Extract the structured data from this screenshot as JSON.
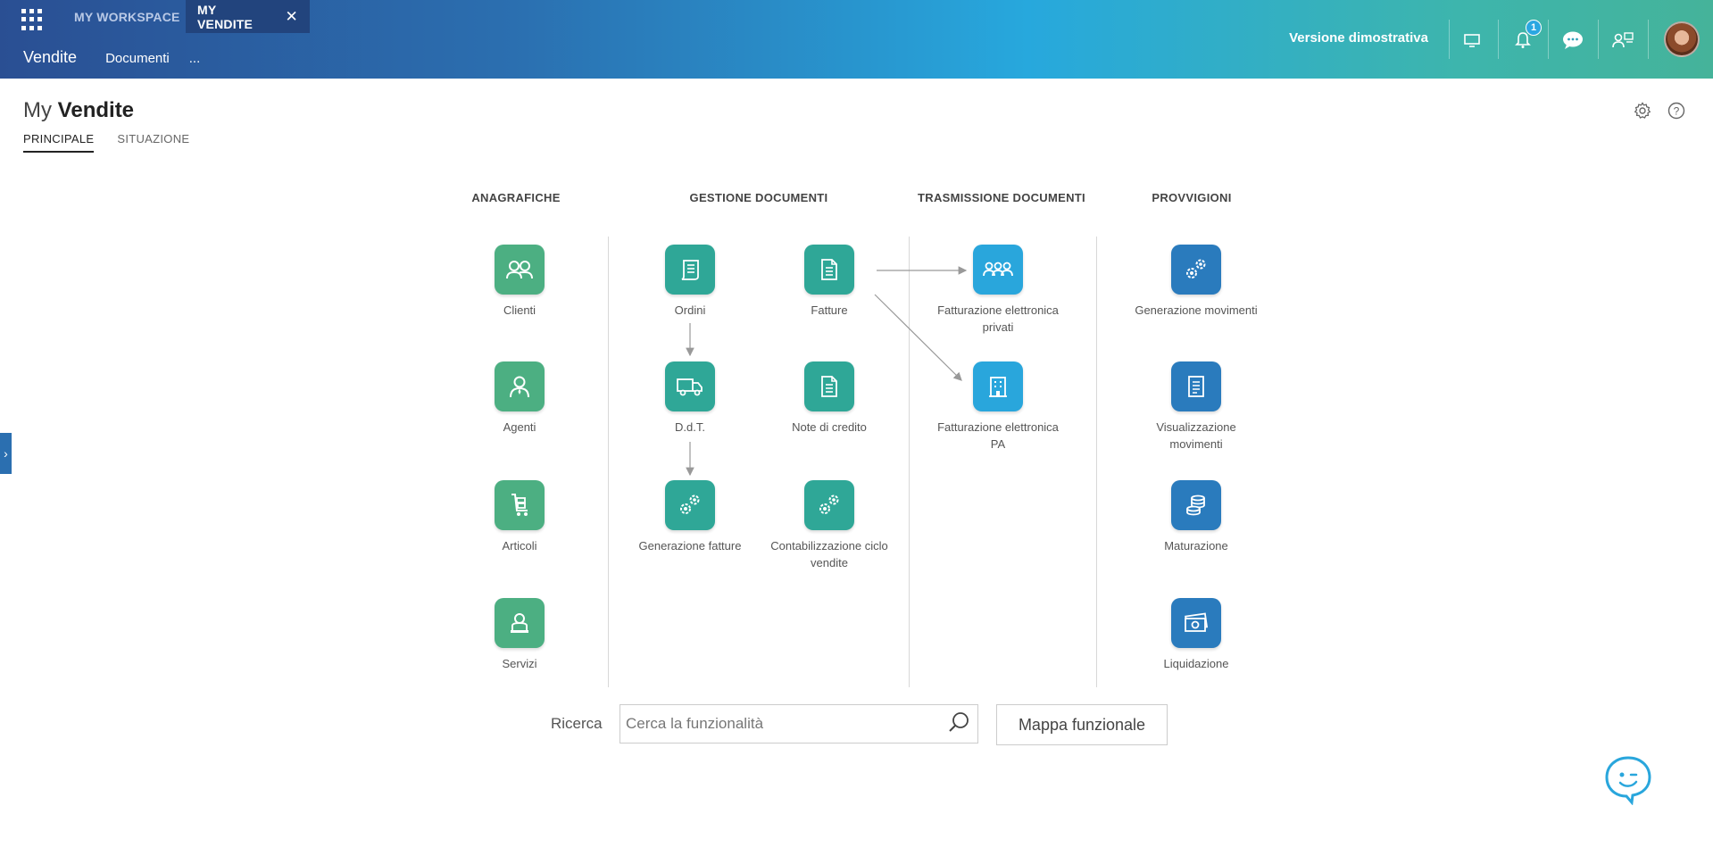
{
  "header": {
    "app_menu_icon": "grid-icon",
    "tabs": [
      {
        "label": "MY WORKSPACE",
        "active": false
      },
      {
        "label": "MY VENDITE",
        "active": true,
        "close": "✕"
      }
    ],
    "subnav": {
      "title": "Vendite",
      "items": [
        "Documenti",
        "..."
      ]
    },
    "demo_label": "Versione dimostrativa",
    "icons": [
      "monitor-icon",
      "bell-icon",
      "chat-icon",
      "users-icon"
    ],
    "notification_count": "1",
    "brand_colors": {
      "start": "#2a4f93",
      "middle": "#27a8dd",
      "end": "#45b39a"
    }
  },
  "page": {
    "title_prefix": "My",
    "title_main": "Vendite",
    "tabs": [
      {
        "label": "PRINCIPALE",
        "active": true
      },
      {
        "label": "SITUAZIONE",
        "active": false
      }
    ],
    "tools": [
      "settings-icon",
      "help-icon"
    ]
  },
  "map": {
    "columns": [
      {
        "title": "ANAGRAFICHE"
      },
      {
        "title": "GESTIONE DOCUMENTI"
      },
      {
        "title": "TRASMISSIONE DOCUMENTI"
      },
      {
        "title": "PROVVIGIONI"
      }
    ],
    "anagrafiche": [
      {
        "label": "Clienti",
        "icon": "users-icon"
      },
      {
        "label": "Agenti",
        "icon": "agent-icon"
      },
      {
        "label": "Articoli",
        "icon": "cart-icon"
      },
      {
        "label": "Servizi",
        "icon": "service-icon"
      }
    ],
    "gestione": [
      {
        "label": "Ordini",
        "icon": "order-icon"
      },
      {
        "label": "Fatture",
        "icon": "document-icon"
      },
      {
        "label": "D.d.T.",
        "icon": "truck-icon"
      },
      {
        "label": "Note di credito",
        "icon": "document-icon"
      },
      {
        "label": "Generazione fatture",
        "icon": "gears-icon"
      },
      {
        "label": "Contabilizzazione ciclo vendite",
        "icon": "gears-icon"
      }
    ],
    "trasmissione": [
      {
        "label": "Fatturazione elettronica privati",
        "icon": "group-icon"
      },
      {
        "label": "Fatturazione elettronica PA",
        "icon": "building-icon"
      }
    ],
    "provvigioni": [
      {
        "label": "Generazione movimenti",
        "icon": "gears-icon"
      },
      {
        "label": "Visualizzazione movimenti",
        "icon": "ledger-icon"
      },
      {
        "label": "Maturazione",
        "icon": "coins-icon"
      },
      {
        "label": "Liquidazione",
        "icon": "cash-icon"
      }
    ],
    "colors": {
      "green": "#4caf82",
      "teal": "#2fa797",
      "sky": "#29a6dc",
      "blue": "#2a7bbd"
    }
  },
  "search": {
    "label": "Ricerca",
    "placeholder": "Cerca la funzionalità",
    "map_button": "Mappa funzionale"
  }
}
